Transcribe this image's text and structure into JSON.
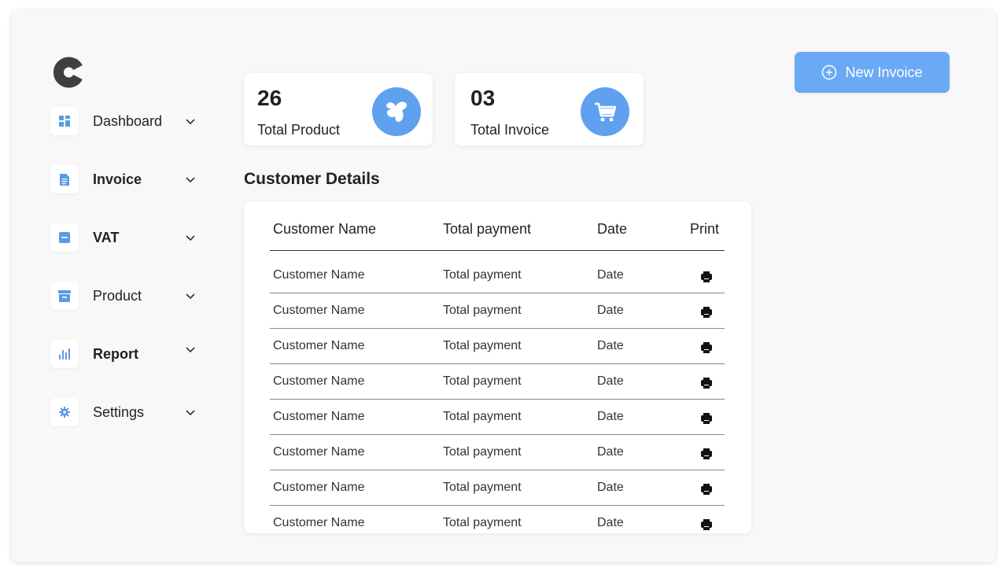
{
  "app": {
    "logo_icon": "c-logo-icon"
  },
  "sidebar": {
    "items": [
      {
        "label": "Dashboard",
        "icon": "dashboard-grid-icon",
        "bold": false
      },
      {
        "label": "Invoice",
        "icon": "document-icon",
        "bold": true
      },
      {
        "label": "VAT",
        "icon": "note-icon",
        "bold": true
      },
      {
        "label": "Product",
        "icon": "archive-box-icon",
        "bold": false
      },
      {
        "label": "Report",
        "icon": "bar-chart-icon",
        "bold": true
      },
      {
        "label": "Settings",
        "icon": "gear-icon",
        "bold": false
      }
    ]
  },
  "stats": [
    {
      "value": "26",
      "label": "Total Product",
      "icon": "product-icon"
    },
    {
      "value": "03",
      "label": "Total Invoice",
      "icon": "cart-icon"
    }
  ],
  "actions": {
    "new_invoice_label": "New Invoice",
    "new_invoice_icon": "plus-circle-icon"
  },
  "customer_details": {
    "title": "Customer Details",
    "columns": [
      "Customer Name",
      "Total payment",
      "Date",
      "Print"
    ],
    "rows": [
      {
        "name": "Customer Name",
        "payment": "Total payment",
        "date": "Date"
      },
      {
        "name": "Customer Name",
        "payment": "Total payment",
        "date": "Date"
      },
      {
        "name": "Customer Name",
        "payment": "Total payment",
        "date": "Date"
      },
      {
        "name": "Customer Name",
        "payment": "Total payment",
        "date": "Date"
      },
      {
        "name": "Customer Name",
        "payment": "Total payment",
        "date": "Date"
      },
      {
        "name": "Customer Name",
        "payment": "Total payment",
        "date": "Date"
      },
      {
        "name": "Customer Name",
        "payment": "Total payment",
        "date": "Date"
      },
      {
        "name": "Customer Name",
        "payment": "Total payment",
        "date": "Date"
      }
    ]
  },
  "colors": {
    "accent": "#5fa1ef",
    "button": "#6aa9f4",
    "background": "#f8f8f8",
    "text": "#222222"
  }
}
